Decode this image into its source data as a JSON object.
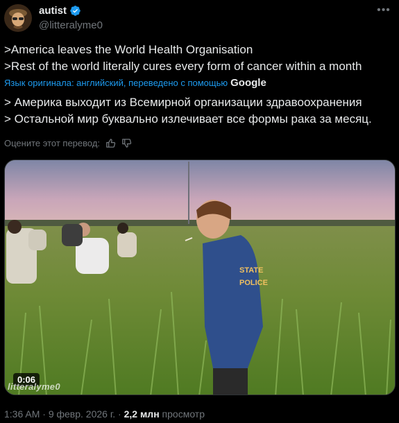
{
  "author": {
    "display_name": "autist",
    "handle": "@litteralyme0",
    "verified": true
  },
  "post": {
    "lines": [
      ">America leaves the World Health Organisation",
      ">Rest of the world literally cures every form of cancer within a month"
    ]
  },
  "translation": {
    "note": "Язык оригинала: английский, переведено с помощью",
    "provider": "Google",
    "lines": [
      "> Америка выходит из Всемирной организации здравоохранения",
      "> Остальной мир буквально излечивает все формы рака за месяц."
    ],
    "rate_prompt": "Оцените этот перевод:"
  },
  "media": {
    "duration": "0:06",
    "watermark": "litteralyme0",
    "jacket_text": [
      "STATE",
      "POLICE"
    ]
  },
  "meta": {
    "time": "1:36 AM",
    "date": "9 февр. 2026 г.",
    "views_count": "2,2 млн",
    "views_label": "просмотр"
  },
  "icons": [
    "verified-badge-icon",
    "more-options-icon",
    "thumbs-up-icon",
    "thumbs-down-icon"
  ],
  "colors": {
    "accent": "#1d9bf0",
    "secondary": "#71767b",
    "text": "#e7e9ea",
    "background": "#000000"
  }
}
